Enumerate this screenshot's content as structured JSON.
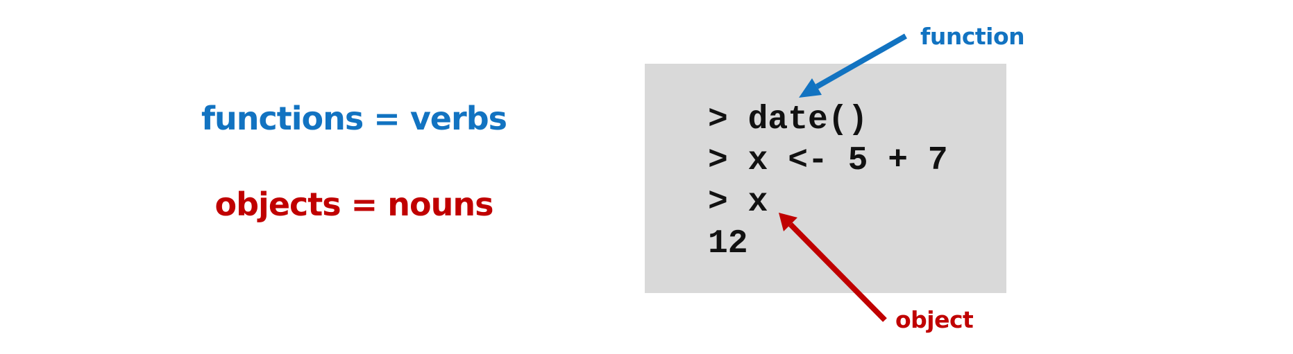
{
  "statements": {
    "functions": "functions = verbs",
    "objects": "objects = nouns"
  },
  "console": {
    "lines": [
      "> date()",
      "> x <- 5 + 7",
      "> x",
      "12"
    ]
  },
  "callouts": {
    "function_label": "function",
    "object_label": "object"
  },
  "colors": {
    "function_blue": "#1273c1",
    "object_red": "#c00000",
    "console_bg": "#d9d9d9",
    "text": "#111111"
  }
}
